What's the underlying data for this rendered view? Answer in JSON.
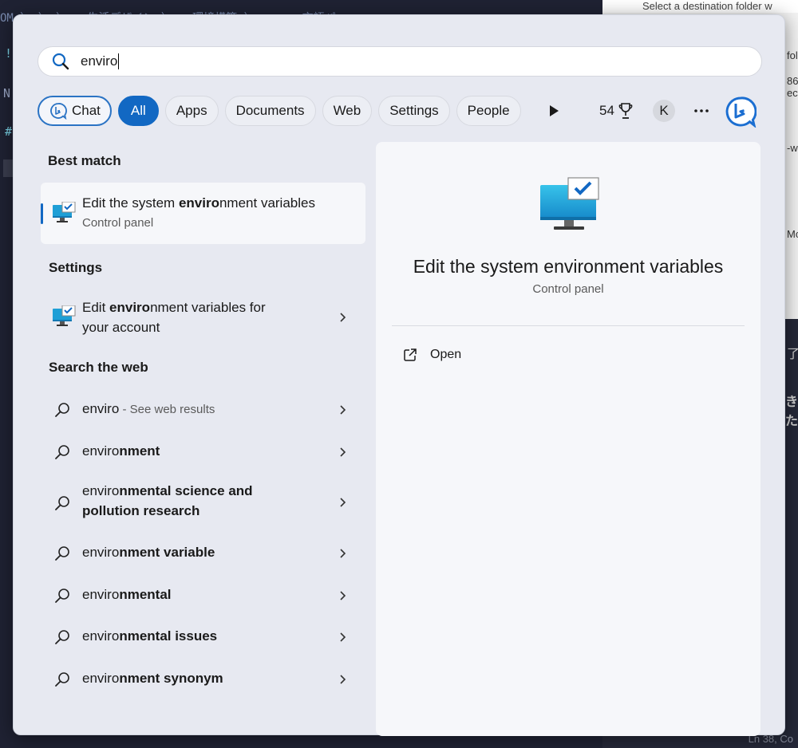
{
  "background": {
    "left_text": "OM  〉 〉 〉  ◻ 生活デザイン  〉 ◻ 環境構築  〉 ◻ ... 言語パ",
    "marks": [
      "!",
      "N",
      "#"
    ],
    "right_top": "Select a destination folder w",
    "frag_fol": "fol",
    "frag_86": "86",
    "frag_ect": "ect",
    "frag_w": "-w",
    "frag_mc": "Mc",
    "frag_jp1": "了",
    "frag_jp2": "きた",
    "status": "Ln 38, Co"
  },
  "search": {
    "value": "enviro",
    "icon": "search-icon"
  },
  "tabs": {
    "chat": "Chat",
    "all": "All",
    "apps": "Apps",
    "documents": "Documents",
    "web": "Web",
    "settings": "Settings",
    "people": "People",
    "points": "54",
    "avatar": "K"
  },
  "best_match": {
    "heading": "Best match",
    "title_pre": "Edit the system ",
    "title_bold": "enviro",
    "title_post": "nment variables",
    "subtitle": "Control panel"
  },
  "settings_section": {
    "heading": "Settings",
    "line1_pre": "Edit ",
    "line1_bold": "enviro",
    "line1_post": "nment variables for",
    "line2": "your account"
  },
  "web_section": {
    "heading": "Search the web",
    "first_query": "enviro",
    "first_hint": " - See web results",
    "items": [
      {
        "pre": "enviro",
        "bold": "nment"
      },
      {
        "pre": "enviro",
        "bold": "nmental science and"
      },
      {
        "pre": "enviro",
        "bold": "nment variable"
      },
      {
        "pre": "enviro",
        "bold": "nmental"
      },
      {
        "pre": "enviro",
        "bold": "nmental issues"
      },
      {
        "pre": "enviro",
        "bold": "nment synonym"
      }
    ],
    "item2_line2": "pollution research"
  },
  "preview": {
    "title": "Edit the system environment variables",
    "subtitle": "Control panel",
    "open_label": "Open"
  },
  "colors": {
    "accent": "#1268c3",
    "panel": "#e7e9f1"
  }
}
